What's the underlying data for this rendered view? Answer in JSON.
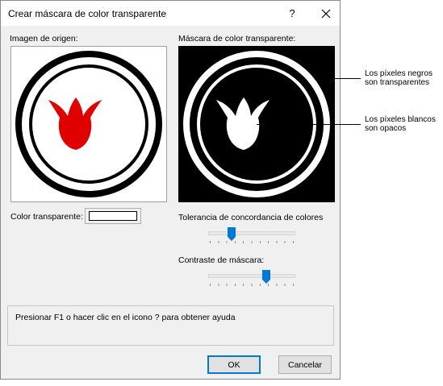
{
  "window": {
    "title": "Crear máscara de color transparente",
    "help_glyph": "?",
    "close_icon": "close-icon"
  },
  "source": {
    "label": "Imagen de origen:"
  },
  "mask": {
    "label": "Máscara de color transparente:"
  },
  "transparent_color": {
    "label": "Color transparente:",
    "value": "#ffffff"
  },
  "tolerance": {
    "label": "Tolerancia de concordancia de colores",
    "level": 0.25
  },
  "contrast": {
    "label": "Contraste de máscara:",
    "level": 0.7
  },
  "help_text": "Presionar F1 o hacer clic en el icono ? para obtener ayuda",
  "buttons": {
    "ok": "OK",
    "cancel": "Cancelar"
  },
  "annotations": {
    "black_line1": "Los píxeles negros",
    "black_line2": "son transparentes",
    "white_line1": "Los píxeles blancos",
    "white_line2": "son opacos"
  },
  "colors": {
    "tulip_fill": "#e00000",
    "accent": "#0078d7"
  }
}
